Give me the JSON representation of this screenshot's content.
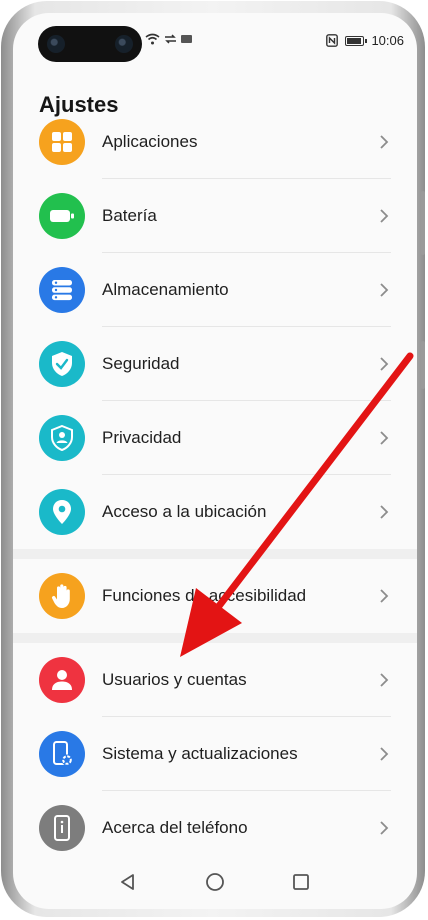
{
  "colors": {
    "orange": "#f6a21e",
    "green": "#22c04e",
    "blue": "#2979e6",
    "teal": "#1ab9c9",
    "red": "#ef3340",
    "gray": "#7d7d7d",
    "arrow": "#e31414"
  },
  "statusbar": {
    "time": "10:06",
    "icons_left": [
      "wifi-icon",
      "data-icon",
      "sim-icon"
    ],
    "icons_right": [
      "nfc-icon",
      "battery-icon"
    ],
    "battery_level": 0.8
  },
  "page": {
    "title": "Ajustes"
  },
  "settings": [
    {
      "label": "Aplicaciones",
      "icon": "apps-icon",
      "color": "#f6a21e"
    },
    {
      "label": "Batería",
      "icon": "battery-icon",
      "color": "#22c04e"
    },
    {
      "label": "Almacenamiento",
      "icon": "storage-icon",
      "color": "#2979e6"
    },
    {
      "label": "Seguridad",
      "icon": "shield-check-icon",
      "color": "#1ab9c9"
    },
    {
      "label": "Privacidad",
      "icon": "privacy-shield-icon",
      "color": "#1ab9c9"
    },
    {
      "label": "Acceso a la ubicación",
      "icon": "location-pin-icon",
      "color": "#1ab9c9"
    },
    {
      "label": "Funciones de accesibilidad",
      "icon": "hand-icon",
      "color": "#f6a21e"
    },
    {
      "label": "Usuarios y cuentas",
      "icon": "user-icon",
      "color": "#ef3340"
    },
    {
      "label": "Sistema y actualizaciones",
      "icon": "system-update-icon",
      "color": "#2979e6"
    },
    {
      "label": "Acerca del teléfono",
      "icon": "phone-info-icon",
      "color": "#7d7d7d"
    }
  ],
  "navbar": {
    "icons": [
      "back-triangle-icon",
      "home-circle-icon",
      "recents-square-icon"
    ]
  }
}
